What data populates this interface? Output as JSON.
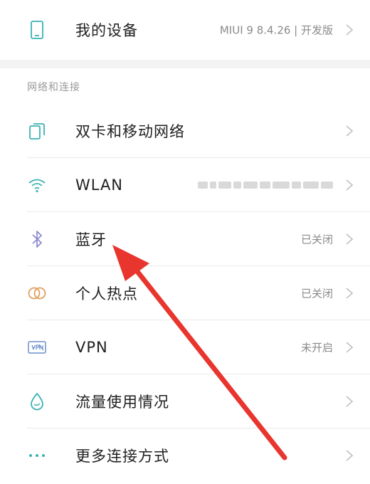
{
  "device": {
    "label": "我的设备",
    "value": "MIUI 9 8.4.26 | 开发版",
    "icon": "phone-icon"
  },
  "section": {
    "header": "网络和连接",
    "items": [
      {
        "id": "dual-sim",
        "label": "双卡和移动网络",
        "value": "",
        "icon": "sim-cards-icon"
      },
      {
        "id": "wlan",
        "label": "WLAN",
        "value": "",
        "icon": "wifi-icon",
        "value_blurred": true
      },
      {
        "id": "bluetooth",
        "label": "蓝牙",
        "value": "已关闭",
        "icon": "bluetooth-icon"
      },
      {
        "id": "hotspot",
        "label": "个人热点",
        "value": "已关闭",
        "icon": "hotspot-icon"
      },
      {
        "id": "vpn",
        "label": "VPN",
        "value": "未开启",
        "icon": "vpn-icon"
      },
      {
        "id": "data-usage",
        "label": "流量使用情况",
        "value": "",
        "icon": "water-drop-icon"
      },
      {
        "id": "more",
        "label": "更多连接方式",
        "value": "",
        "icon": "more-dots-icon"
      }
    ]
  },
  "colors": {
    "accent": "#3bb3b3",
    "arrow": "#e8352e",
    "chevron": "#c4c4c4"
  }
}
